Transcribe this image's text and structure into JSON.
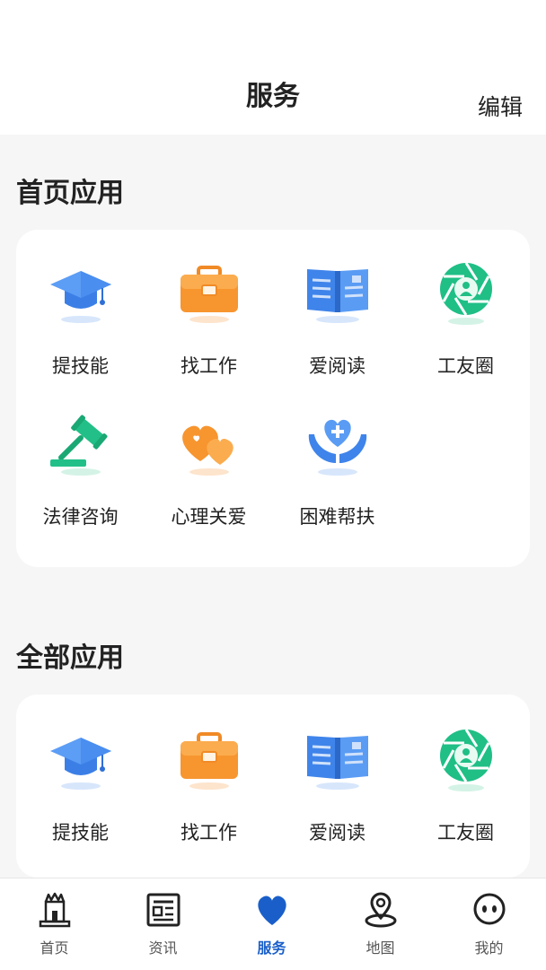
{
  "header": {
    "title": "服务",
    "edit_label": "编辑"
  },
  "sections": [
    {
      "title": "首页应用",
      "apps": [
        {
          "label": "提技能",
          "icon": "graduation-cap-icon"
        },
        {
          "label": "找工作",
          "icon": "briefcase-icon"
        },
        {
          "label": "爱阅读",
          "icon": "book-icon"
        },
        {
          "label": "工友圈",
          "icon": "camera-aperture-icon"
        },
        {
          "label": "法律咨询",
          "icon": "gavel-icon"
        },
        {
          "label": "心理关爱",
          "icon": "hearts-icon"
        },
        {
          "label": "困难帮扶",
          "icon": "helping-hands-icon"
        }
      ]
    },
    {
      "title": "全部应用",
      "apps": [
        {
          "label": "提技能",
          "icon": "graduation-cap-icon"
        },
        {
          "label": "找工作",
          "icon": "briefcase-icon"
        },
        {
          "label": "爱阅读",
          "icon": "book-icon"
        },
        {
          "label": "工友圈",
          "icon": "camera-aperture-icon"
        }
      ]
    }
  ],
  "tabbar": {
    "active": "服务",
    "active_color": "#1a5fc9",
    "items": [
      {
        "label": "首页",
        "icon": "home-icon"
      },
      {
        "label": "资讯",
        "icon": "news-icon"
      },
      {
        "label": "服务",
        "icon": "heart-icon"
      },
      {
        "label": "地图",
        "icon": "map-pin-icon"
      },
      {
        "label": "我的",
        "icon": "face-icon"
      }
    ]
  }
}
